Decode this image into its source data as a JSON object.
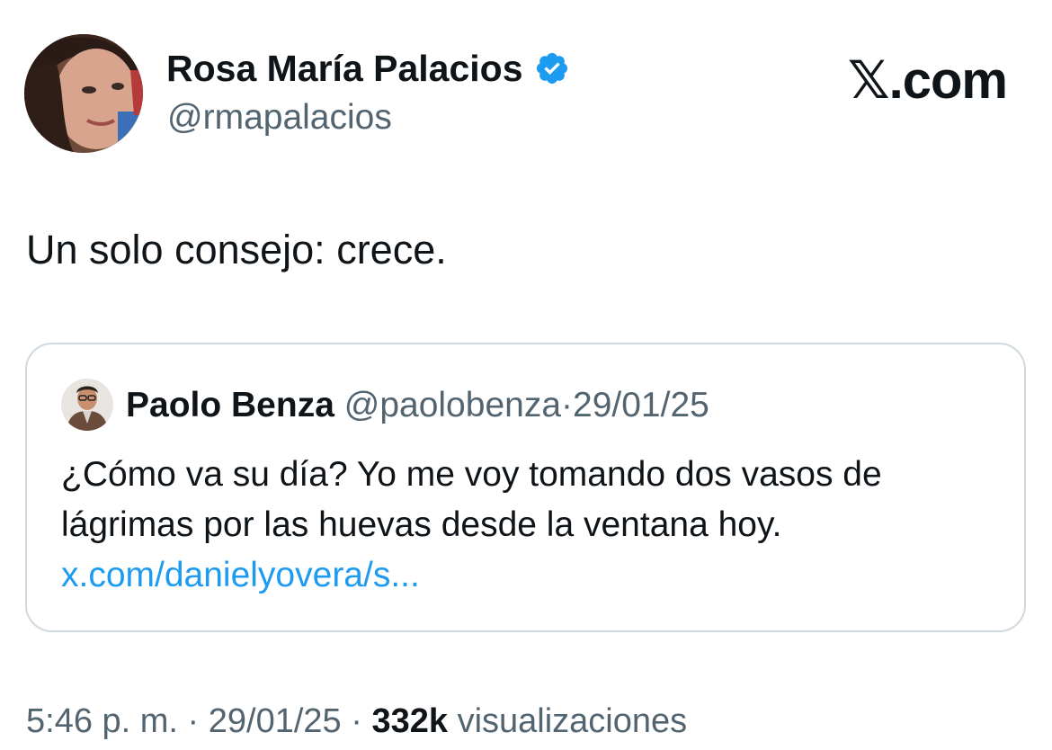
{
  "author": {
    "name": "Rosa María Palacios",
    "handle": "@rmapalacios",
    "verified": true
  },
  "brand": {
    "logo_text": "𝕏.com"
  },
  "tweet": {
    "text": "Un solo consejo: crece."
  },
  "quote": {
    "name": "Paolo Benza",
    "handle": "@paolobenza",
    "separator": "·",
    "date": "29/01/25",
    "text_lines": [
      "¿Cómo va su día? Yo me voy tomando dos vasos de",
      "lágrimas por las huevas desde la ventana hoy."
    ],
    "link": "x.com/danielyovera/s..."
  },
  "meta": {
    "time": "5:46 p. m.",
    "separator": "·",
    "date": "29/01/25",
    "views_count": "332k",
    "views_label": "visualizaciones"
  },
  "colors": {
    "text_primary": "#0f1419",
    "text_secondary": "#536471",
    "link": "#1d9bf0",
    "verified_badge": "#1d9bf0",
    "card_border": "#cfd9de"
  }
}
